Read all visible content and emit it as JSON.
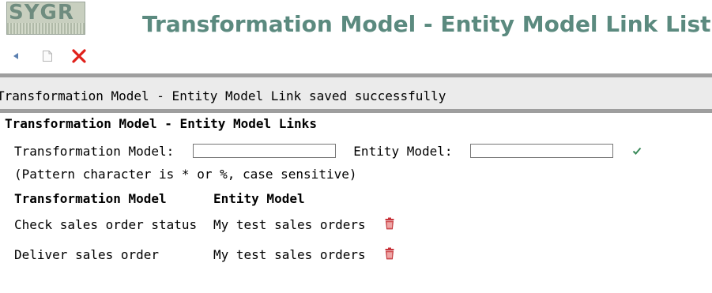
{
  "logo": {
    "text": "SYGR"
  },
  "page": {
    "title": "Transformation Model - Entity Model Link List"
  },
  "toolbar": {
    "back_icon": "back-arrow-icon",
    "new_icon": "new-document-icon",
    "close_icon": "close-x-icon",
    "close_color": "#e0201a"
  },
  "message": {
    "text": "Transformation Model - Entity Model Link saved successfully"
  },
  "section": {
    "title": "Transformation Model - Entity Model Links"
  },
  "filter": {
    "transformation_label": "Transformation Model:",
    "transformation_value": "",
    "entity_label": "Entity Model:",
    "entity_value": "",
    "apply_icon": "checkmark-icon",
    "apply_color": "#3a8a5a",
    "hint": "(Pattern character is * or %, case sensitive)"
  },
  "table": {
    "columns": [
      "Transformation Model",
      "Entity Model"
    ],
    "rows": [
      {
        "transformation_model": "Check sales order status",
        "entity_model": "My test sales orders",
        "delete_icon": "trash-icon"
      },
      {
        "transformation_model": "Deliver sales order",
        "entity_model": "My test sales orders",
        "delete_icon": "trash-icon"
      }
    ],
    "delete_color": "#c8323a"
  }
}
